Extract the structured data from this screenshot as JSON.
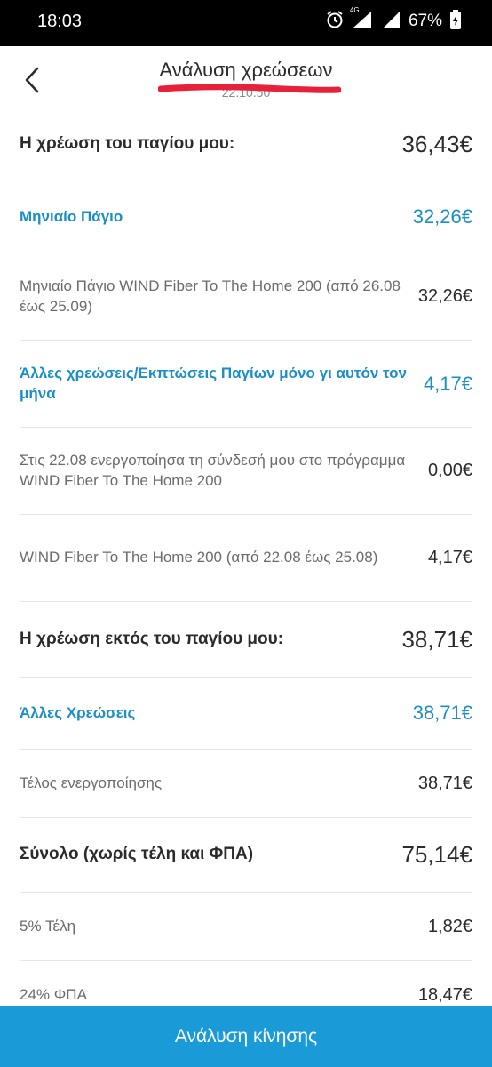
{
  "status_bar": {
    "time": "18:03",
    "network": "4G",
    "battery": "67%",
    "icons": [
      "alarm-icon",
      "signal-icon",
      "wifi-icon",
      "battery-icon"
    ]
  },
  "header": {
    "title": "Ανάλυση χρεώσεων",
    "subtitle": "22.10.50",
    "back_icon": "chevron-left-icon"
  },
  "rows": [
    {
      "type": "section",
      "label": "Η χρέωση του παγίου μου:",
      "amount": "36,43€"
    },
    {
      "type": "group",
      "label": "Μηνιαίο Πάγιο",
      "amount": "32,26€"
    },
    {
      "type": "item",
      "label": "Μηνιαίο Πάγιο WIND Fiber To The Home 200 (από 26.08 έως 25.09)",
      "amount": "32,26€"
    },
    {
      "type": "group",
      "label": "Άλλες χρεώσεις/Εκπτώσεις Παγίων μόνο γι αυτόν τον μήνα",
      "amount": "4,17€"
    },
    {
      "type": "item",
      "label": "Στις 22.08 ενεργοποίησα τη σύνδεσή μου στο πρόγραμμα WIND Fiber To The Home 200",
      "amount": "0,00€"
    },
    {
      "type": "item",
      "label": "WIND Fiber To The Home 200 (από 22.08 έως 25.08)",
      "amount": "4,17€"
    },
    {
      "type": "section",
      "label": "Η χρέωση εκτός του παγίου μου:",
      "amount": "38,71€"
    },
    {
      "type": "group",
      "label": "Άλλες Χρεώσεις",
      "amount": "38,71€"
    },
    {
      "type": "item",
      "label": "Τέλος ενεργοποίησης",
      "amount": "38,71€"
    },
    {
      "type": "section",
      "label": "Σύνολο (χωρίς τέλη και ΦΠΑ)",
      "amount": "75,14€"
    },
    {
      "type": "item",
      "label": "5% Τέλη",
      "amount": "1,82€"
    },
    {
      "type": "item",
      "label": "24% ΦΠΑ",
      "amount": "18,47€"
    }
  ],
  "bottom_button": {
    "label": "Ανάλυση κίνησης"
  },
  "colors": {
    "accent": "#1a9ad6",
    "group_text": "#1a8fc7",
    "annotation": "#e8213b"
  }
}
